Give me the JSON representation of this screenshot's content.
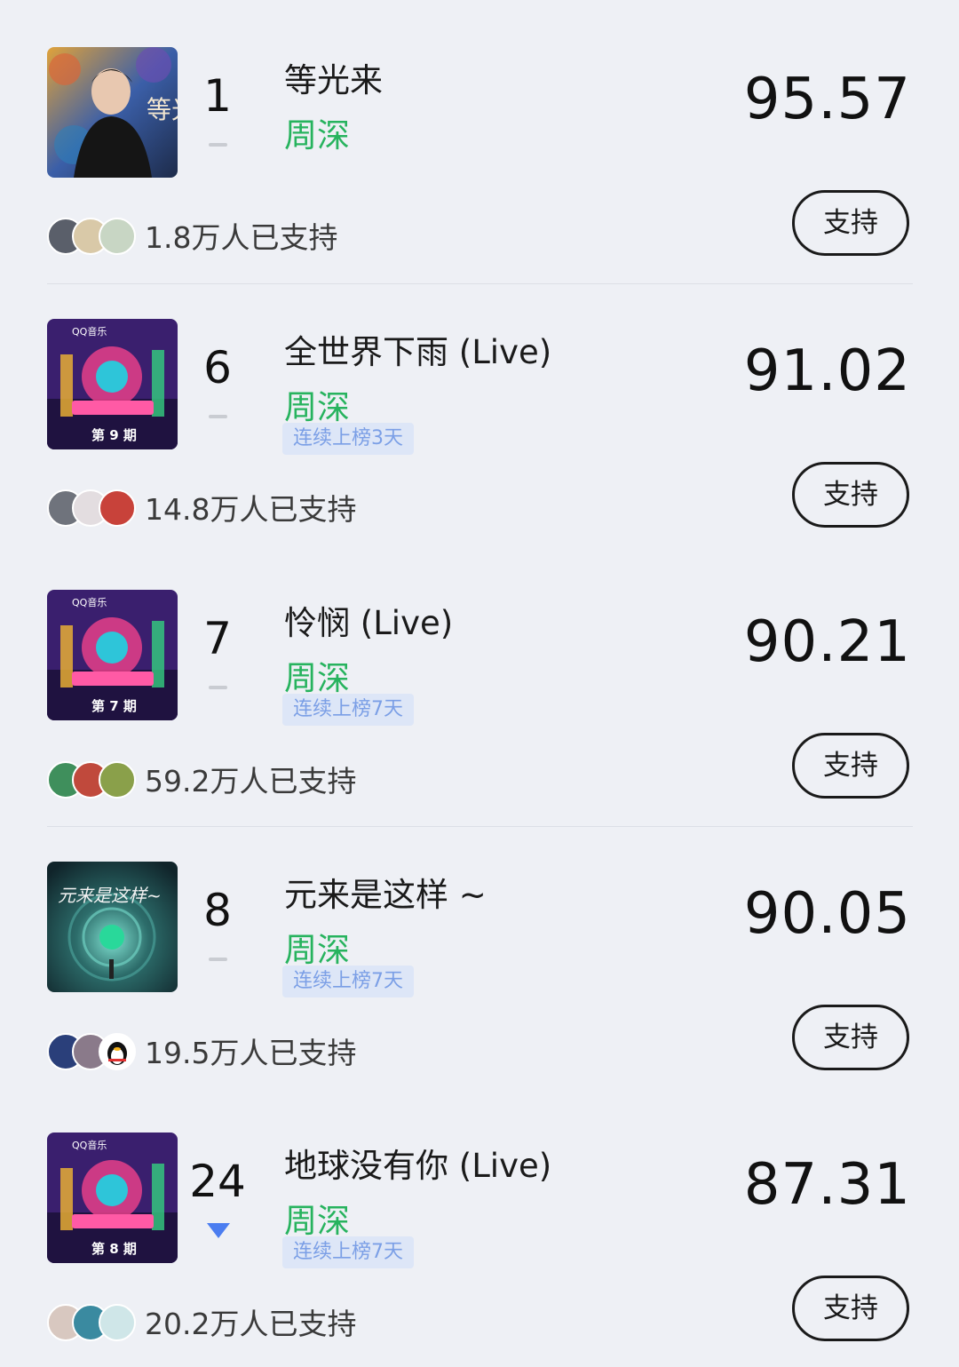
{
  "entries": [
    {
      "rank": "1",
      "trend": "flat",
      "title": "等光来",
      "artist": "周深",
      "streak": "",
      "score": "95.57",
      "supporters": "1.8万人已支持",
      "support_label": "支持",
      "cover": "cover-portrait",
      "cover_text": "等光来"
    },
    {
      "rank": "6",
      "trend": "flat",
      "title": "全世界下雨 (Live)",
      "artist": "周深",
      "streak": "连续上榜3天",
      "score": "91.02",
      "supporters": "14.8万人已支持",
      "support_label": "支持",
      "cover": "cover-show",
      "cover_text": "第 9 期",
      "cover_brand": "QQ音乐"
    },
    {
      "rank": "7",
      "trend": "flat",
      "title": "怜悯 (Live)",
      "artist": "周深",
      "streak": "连续上榜7天",
      "score": "90.21",
      "supporters": "59.2万人已支持",
      "support_label": "支持",
      "cover": "cover-show",
      "cover_text": "第 7 期",
      "cover_brand": "QQ音乐"
    },
    {
      "rank": "8",
      "trend": "flat",
      "title": "元来是这样 ~",
      "artist": "周深",
      "streak": "连续上榜7天",
      "score": "90.05",
      "supporters": "19.5万人已支持",
      "support_label": "支持",
      "cover": "cover-tunnel",
      "cover_text": "元来是这样~"
    },
    {
      "rank": "24",
      "trend": "down",
      "title": "地球没有你 (Live)",
      "artist": "周深",
      "streak": "连续上榜7天",
      "score": "87.31",
      "supporters": "20.2万人已支持",
      "support_label": "支持",
      "cover": "cover-show",
      "cover_text": "第 8 期",
      "cover_brand": "QQ音乐"
    }
  ],
  "colors": {
    "background": "#eef0f5",
    "artist": "#27b35e",
    "streak_bg": "#dde6f7",
    "streak_text": "#7b9fe6",
    "trend_down": "#4b7df0"
  }
}
